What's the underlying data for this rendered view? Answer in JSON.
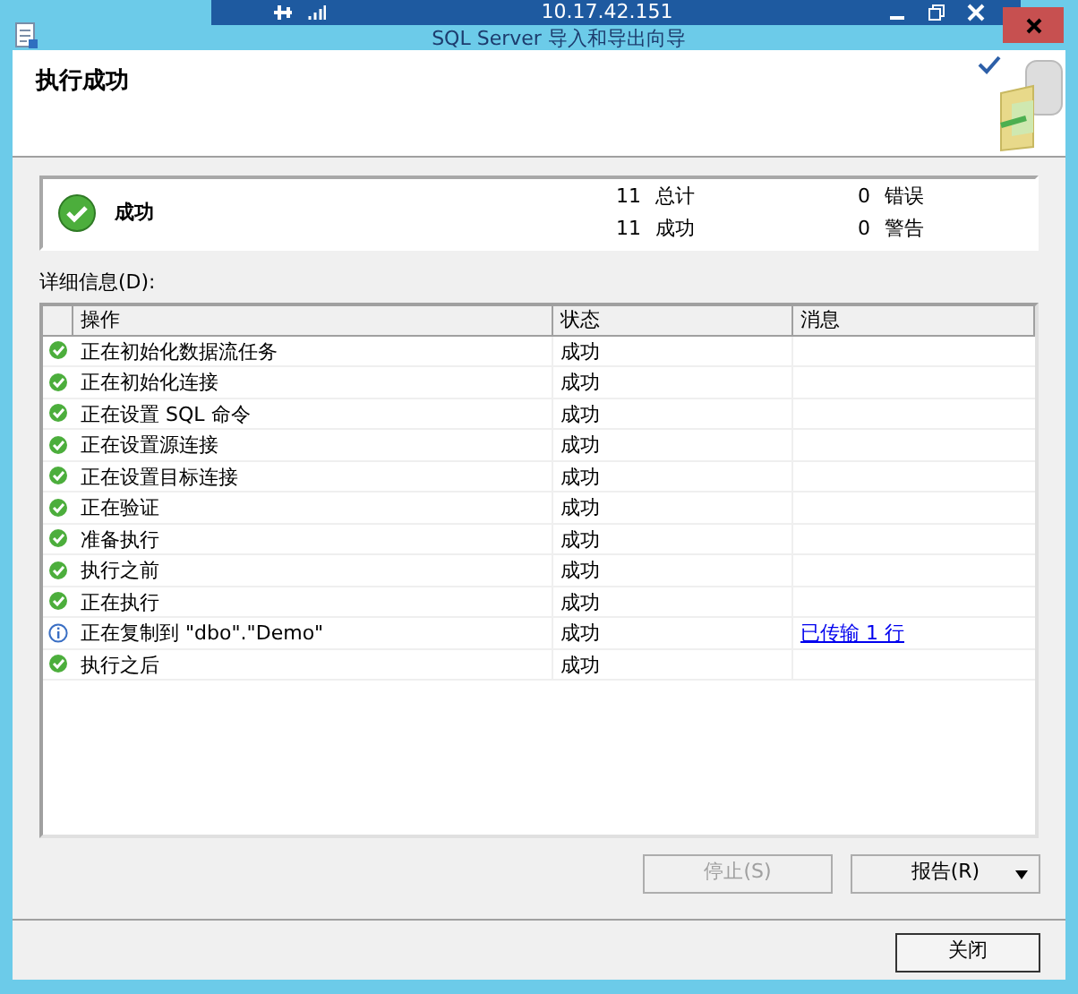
{
  "remote_bar": {
    "address": "10.17.42.151"
  },
  "window": {
    "title": "SQL Server 导入和导出向导"
  },
  "header": {
    "title": "执行成功"
  },
  "summary": {
    "status": "成功",
    "total": "11",
    "total_label": "总计",
    "success": "11",
    "success_label": "成功",
    "errors": "0",
    "errors_label": "错误",
    "warnings": "0",
    "warnings_label": "警告"
  },
  "details_label": "详细信息(D):",
  "table": {
    "columns": [
      "操作",
      "状态",
      "消息"
    ],
    "rows": [
      {
        "kind": "success",
        "action": "正在初始化数据流任务",
        "status": "成功"
      },
      {
        "kind": "success",
        "action": "正在初始化连接",
        "status": "成功"
      },
      {
        "kind": "success",
        "action": "正在设置 SQL 命令",
        "status": "成功"
      },
      {
        "kind": "success",
        "action": "正在设置源连接",
        "status": "成功"
      },
      {
        "kind": "success",
        "action": "正在设置目标连接",
        "status": "成功"
      },
      {
        "kind": "success",
        "action": "正在验证",
        "status": "成功"
      },
      {
        "kind": "success",
        "action": "准备执行",
        "status": "成功"
      },
      {
        "kind": "success",
        "action": "执行之前",
        "status": "成功"
      },
      {
        "kind": "success",
        "action": "正在执行",
        "status": "成功"
      },
      {
        "kind": "info",
        "action": "正在复制到 \"dbo\".\"Demo\"",
        "status": "成功",
        "message": "已传输 1 行"
      },
      {
        "kind": "success",
        "action": "执行之后",
        "status": "成功"
      }
    ]
  },
  "buttons": [
    {
      "label": "停止(S)",
      "disabled": true
    },
    {
      "label": "报告(R)",
      "disabled": false,
      "dropdown": true
    }
  ],
  "close_button": "关闭"
}
